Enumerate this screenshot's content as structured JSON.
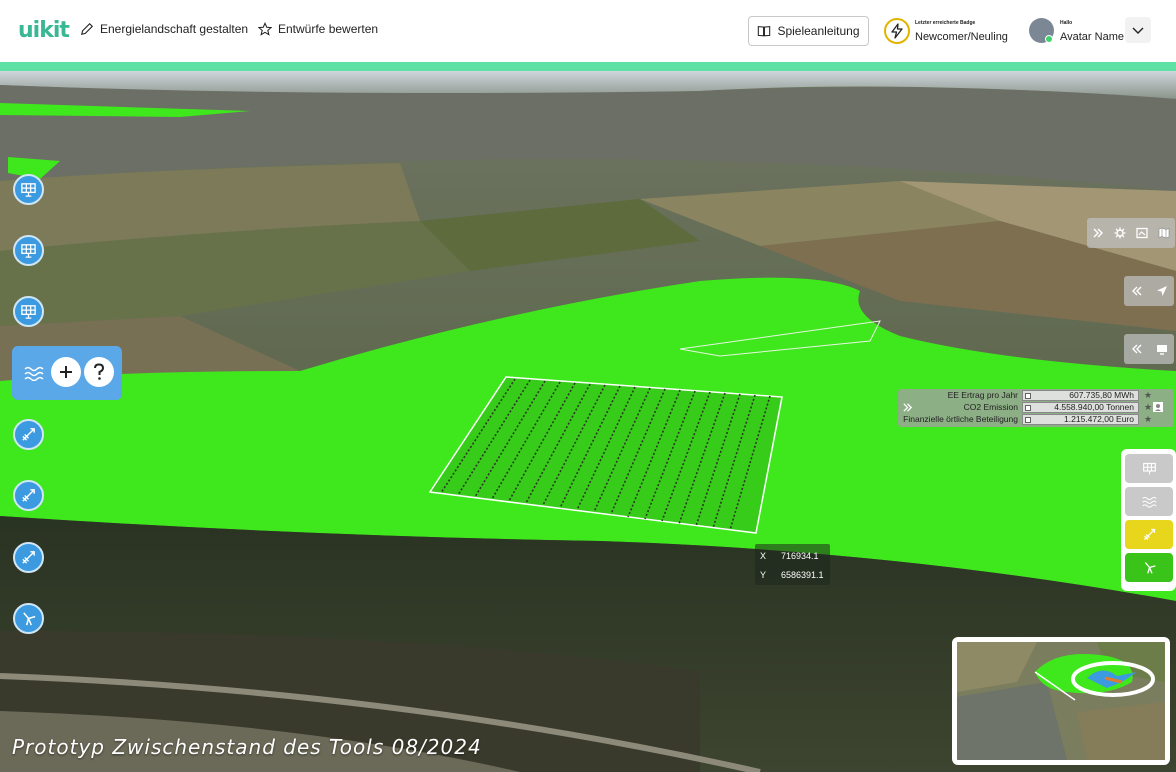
{
  "header": {
    "logo": "uikit",
    "nav": [
      {
        "label": "Energielandschaft gestalten",
        "icon": "pencil-icon"
      },
      {
        "label": "Entwürfe bewerten",
        "icon": "star-icon"
      }
    ],
    "guide_button": "Spieleanleitung",
    "badge": {
      "caption": "Letzter erreicherte Badge",
      "name": "Newcomer/Neuling",
      "icon": "lightning-icon"
    },
    "user": {
      "greeting": "Hallo",
      "name": "Avatar Name"
    }
  },
  "stats": [
    {
      "label": "EE Ertrag pro Jahr",
      "value": "607.735,80 MWh"
    },
    {
      "label": "CO2 Emission",
      "value": "4.558.940,00 Tonnen"
    },
    {
      "label": "Finanzielle örtliche Beteiligung",
      "value": "1.215.472,00 Euro"
    }
  ],
  "coords": {
    "x_label": "X",
    "x": "716934.1",
    "y_label": "Y",
    "y": "6586391.1"
  },
  "caption": "Prototyp Zwischenstand des Tools 08/2024",
  "colors": {
    "accent": "#5fe0a4",
    "brand": "#3ab795",
    "tool_blue": "#3b9ae0",
    "area_green": "#3ee81c",
    "layer_yellow": "#e8d61c",
    "layer_green": "#3ac41a"
  }
}
